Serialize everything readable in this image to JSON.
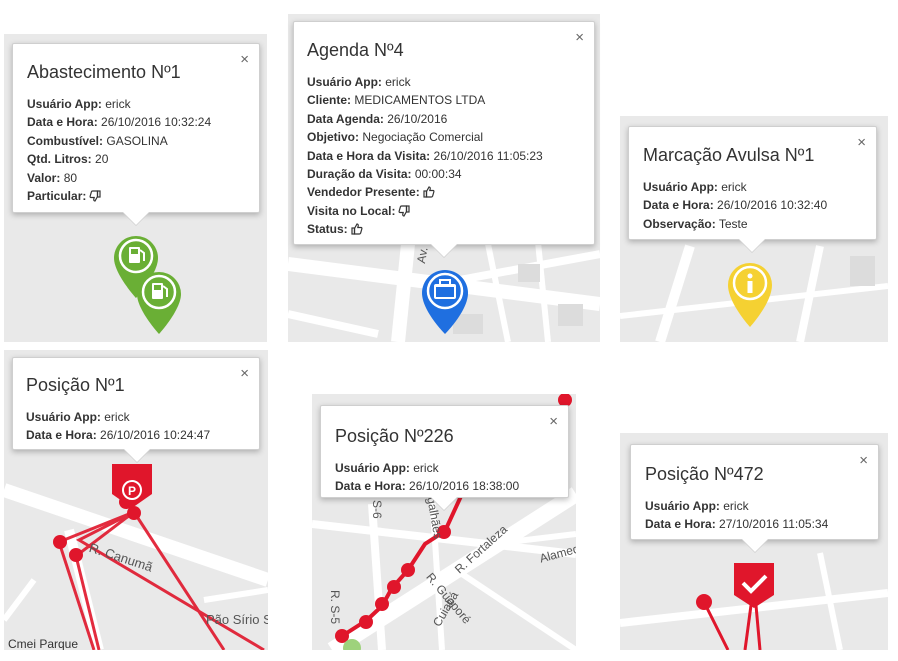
{
  "popups": {
    "abastecimento": {
      "title": "Abastecimento Nº1",
      "rows": [
        {
          "label": "Usuário App:",
          "value": "erick"
        },
        {
          "label": "Data e Hora:",
          "value": "26/10/2016 10:32:24"
        },
        {
          "label": "Combustível:",
          "value": "GASOLINA"
        },
        {
          "label": "Qtd. Litros:",
          "value": "20"
        },
        {
          "label": "Valor:",
          "value": "80"
        },
        {
          "label": "Particular:",
          "icon": "thumbs-down-icon"
        }
      ]
    },
    "agenda": {
      "title": "Agenda Nº4",
      "rows": [
        {
          "label": "Usuário App:",
          "value": "erick"
        },
        {
          "label": "Cliente:",
          "value": "MEDICAMENTOS LTDA"
        },
        {
          "label": "Data Agenda:",
          "value": "26/10/2016"
        },
        {
          "label": "Objetivo:",
          "value": "Negociação Comercial"
        },
        {
          "label": "Data e Hora da Visita:",
          "value": "26/10/2016 11:05:23"
        },
        {
          "label": "Duração da Visita:",
          "value": "00:00:34"
        },
        {
          "label": "Vendedor Presente:",
          "icon": "thumbs-up-icon"
        },
        {
          "label": "Visita no Local:",
          "icon": "thumbs-down-icon"
        },
        {
          "label": "Status:",
          "icon": "thumbs-up-icon"
        }
      ]
    },
    "marcacao": {
      "title": "Marcação Avulsa Nº1",
      "rows": [
        {
          "label": "Usuário App:",
          "value": "erick"
        },
        {
          "label": "Data e Hora:",
          "value": "26/10/2016 10:32:40"
        },
        {
          "label": "Observação:",
          "value": "Teste"
        }
      ]
    },
    "posicao1": {
      "title": "Posição Nº1",
      "rows": [
        {
          "label": "Usuário App:",
          "value": "erick"
        },
        {
          "label": "Data e Hora:",
          "value": "26/10/2016 10:24:47"
        }
      ]
    },
    "posicao226": {
      "title": "Posição Nº226",
      "rows": [
        {
          "label": "Usuário App:",
          "value": "erick"
        },
        {
          "label": "Data e Hora:",
          "value": "26/10/2016 18:38:00"
        }
      ]
    },
    "posicao472": {
      "title": "Posição Nº472",
      "rows": [
        {
          "label": "Usuário App:",
          "value": "erick"
        },
        {
          "label": "Data e Hora:",
          "value": "27/10/2016 11:05:34"
        }
      ]
    }
  },
  "close_glyph": "×",
  "map_labels": {
    "r_canuma": "R. Canumã",
    "pao_sirio": "Pão Sírio S",
    "cmei": "Cmei Parque",
    "r_fortaleza": "R. Fortaleza",
    "r_guapore": "R. Guaporé",
    "cuiaba": "Cuiabá",
    "alamed": "Alamed",
    "ws": "R. S-5",
    "s6": "S-6",
    "magalhaes": "galhães",
    "av_se": "Av. Se"
  },
  "markers": {
    "fuel": "fuel-pump-icon",
    "agenda": "briefcase-icon",
    "info": "info-icon",
    "parking": "parking-icon",
    "check": "checkmark-icon"
  },
  "colors": {
    "fuel_green": "#6aaf35",
    "agenda_blue": "#1f6fe0",
    "info_yellow": "#f5d132",
    "track_red": "#e0162b"
  }
}
